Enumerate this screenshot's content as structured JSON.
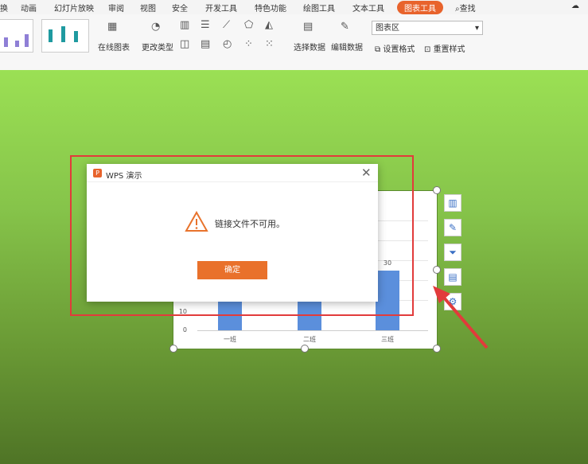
{
  "tabs": [
    "换",
    "动画",
    "幻灯片放映",
    "审阅",
    "视图",
    "安全",
    "开发工具",
    "特色功能",
    "绘图工具",
    "文本工具",
    "图表工具"
  ],
  "search_label": "查找",
  "ribbon": {
    "online_chart": "在线图表",
    "change_type": "更改类型",
    "select_data": "选择数据",
    "edit_data": "编辑数据",
    "chart_area": "图表区",
    "set_format": "设置格式",
    "reset_style": "重置样式"
  },
  "chart_data": {
    "type": "bar",
    "categories": [
      "一班",
      "二班",
      "三班"
    ],
    "values": [
      null,
      null,
      30
    ],
    "data_labels": [
      "",
      "",
      "30"
    ],
    "y_ticks": [
      "0",
      "10"
    ],
    "ylim": [
      0,
      60
    ],
    "grid": true,
    "bar_color": "#5b8fdc"
  },
  "dialog": {
    "title": "WPS 演示",
    "message": "链接文件不可用。",
    "ok": "确定"
  },
  "colors": {
    "accent": "#e8632c",
    "highlight": "#e23b3b"
  }
}
